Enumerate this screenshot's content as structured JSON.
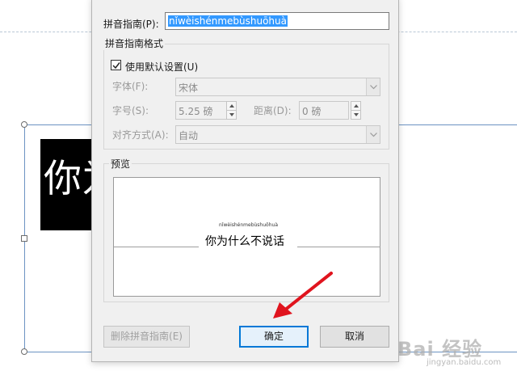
{
  "dialog": {
    "base_text_label": "拼音指南(P):",
    "base_text_value": "nǐwèishénmebùshuōhuà",
    "format_group_title": "拼音指南格式",
    "use_default_label": "使用默认设置(U)",
    "use_default_checked": true,
    "font_label": "字体(F):",
    "font_value": "宋体",
    "size_label": "字号(S):",
    "size_value": "5.25 磅",
    "distance_label": "距离(D):",
    "distance_value": "0 磅",
    "align_label": "对齐方式(A):",
    "align_value": "自动",
    "preview_group_title": "预览",
    "preview_ruby": "nǐwèishénmebùshuōhuà",
    "preview_text": "你为什么不说话",
    "remove_button": "删除拼音指南(E)",
    "ok_button": "确定",
    "cancel_button": "取消"
  },
  "document": {
    "big_text": "你为"
  },
  "watermark": {
    "main": "Bai 经验",
    "sub": "jingyan.baidu.com"
  },
  "colors": {
    "accent": "#0078d7",
    "arrow": "#e0141e",
    "selection": "#3399ff"
  }
}
